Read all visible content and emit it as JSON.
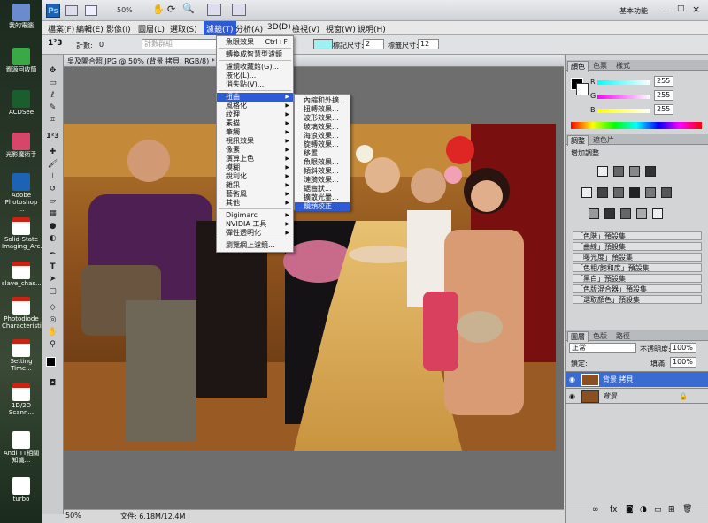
{
  "desktop": {
    "icons": [
      {
        "label": "我的電腦",
        "icon": "computer-icon",
        "color": "#6a8ccf"
      },
      {
        "label": "資源回收筒",
        "icon": "recycle-bin-icon",
        "color": "#3aa845"
      },
      {
        "label": "ACDSee",
        "icon": "acdsee-icon",
        "color": "#1a5e2e"
      },
      {
        "label": "光影魔術手",
        "icon": "photo-tool-icon",
        "color": "#d8456a"
      },
      {
        "label": "Adobe Photoshop ...",
        "icon": "photoshop-icon",
        "color": "#1d63b5"
      },
      {
        "label": "Solid-State Imaging_Arc...",
        "icon": "pdf-icon",
        "color": "#ffffff"
      },
      {
        "label": "slave_chas...",
        "icon": "pdf-icon",
        "color": "#ffffff"
      },
      {
        "label": "Photodiode Characteristi...",
        "icon": "pdf-icon",
        "color": "#ffffff"
      },
      {
        "label": "Setting Time...",
        "icon": "pdf-icon",
        "color": "#ffffff"
      },
      {
        "label": "1D/2D Scann...",
        "icon": "pdf-icon",
        "color": "#ffffff"
      },
      {
        "label": "Andi TT相關 知識...",
        "icon": "document-icon",
        "color": "#ffffff"
      },
      {
        "label": "turbo",
        "icon": "document-icon",
        "color": "#ffffff"
      }
    ]
  },
  "app": {
    "logo": "Ps",
    "zoom": "50%",
    "workspace": "基本功能",
    "window_controls": [
      "－",
      "□",
      "×"
    ]
  },
  "menubar": {
    "items": [
      "檔案(F)",
      "編輯(E)",
      "影像(I)",
      "圖層(L)",
      "選取(S)",
      "濾鏡(T)",
      "分析(A)",
      "3D(D)",
      "檢視(V)",
      "視窗(W)",
      "說明(H)"
    ],
    "active_index": 5
  },
  "options": {
    "tool_icon": "1²3",
    "count_label": "計數:",
    "count_value": "0",
    "group_placeholder": "計數群組",
    "marker_size_label": "標記尺寸:",
    "marker_size_value": "2",
    "label_size_label": "標籤尺寸:",
    "label_size_value": "12",
    "swatch_color": "#9ff0f0"
  },
  "document": {
    "tab_title": "吳及闔合照.JPG @ 50% (背景 拷貝, RGB/8) *",
    "status_zoom": "50%",
    "status_file": "文件: 6.18M/12.4M"
  },
  "filter_menu": {
    "items": [
      {
        "label": "魚眼效果",
        "shortcut": "Ctrl+F"
      },
      {
        "label": "轉換成智慧型濾鏡"
      },
      {
        "label": "濾鏡收藏館(G)..."
      },
      {
        "label": "液化(L)..."
      },
      {
        "label": "消失點(V)..."
      },
      {
        "label": "扭曲",
        "submenu": true,
        "highlight": true
      },
      {
        "label": "風格化",
        "submenu": true
      },
      {
        "label": "紋理",
        "submenu": true
      },
      {
        "label": "素描",
        "submenu": true
      },
      {
        "label": "筆觸",
        "submenu": true
      },
      {
        "label": "視訊效果",
        "submenu": true
      },
      {
        "label": "像素",
        "submenu": true
      },
      {
        "label": "演算上色",
        "submenu": true
      },
      {
        "label": "模糊",
        "submenu": true
      },
      {
        "label": "銳利化",
        "submenu": true
      },
      {
        "label": "雜訊",
        "submenu": true
      },
      {
        "label": "藝術風",
        "submenu": true
      },
      {
        "label": "其他",
        "submenu": true
      },
      {
        "label": "Digimarc",
        "submenu": true
      },
      {
        "label": "NVIDIA 工具",
        "submenu": true
      },
      {
        "label": "彈性透明化",
        "submenu": true
      },
      {
        "label": "瀏覽網上濾鏡..."
      }
    ]
  },
  "distort_submenu": {
    "items": [
      "內縮和外擴...",
      "扭轉效果...",
      "波形效果...",
      "玻璃效果...",
      "海浪效果...",
      "旋轉效果...",
      "移置...",
      "魚眼效果...",
      "傾斜效果...",
      "漣漪效果...",
      "鋸齒狀...",
      "擴散光暈...",
      "鏡頭校正..."
    ],
    "highlight_index": 12
  },
  "color_panel": {
    "tabs": [
      "顏色",
      "色票",
      "樣式"
    ],
    "channels": [
      {
        "label": "R",
        "value": "255"
      },
      {
        "label": "G",
        "value": "255"
      },
      {
        "label": "B",
        "value": "255"
      }
    ]
  },
  "adjust_panel": {
    "tabs": [
      "調整",
      "遮色片"
    ],
    "title": "增加調整",
    "presets": [
      "「色階」預設集",
      "「曲線」預設集",
      "「曝光度」預設集",
      "「色相/飽和度」預設集",
      "「黑白」預設集",
      "「色版混合器」預設集",
      "「選取顏色」預設集"
    ]
  },
  "layers_panel": {
    "tabs": [
      "圖層",
      "色版",
      "路徑"
    ],
    "blend_mode": "正常",
    "opacity_label": "不透明度:",
    "opacity_value": "100%",
    "lock_label": "鎖定:",
    "fill_label": "填滿:",
    "fill_value": "100%",
    "layers": [
      {
        "name": "背景 拷貝",
        "selected": true
      },
      {
        "name": "背景",
        "selected": false
      }
    ]
  }
}
